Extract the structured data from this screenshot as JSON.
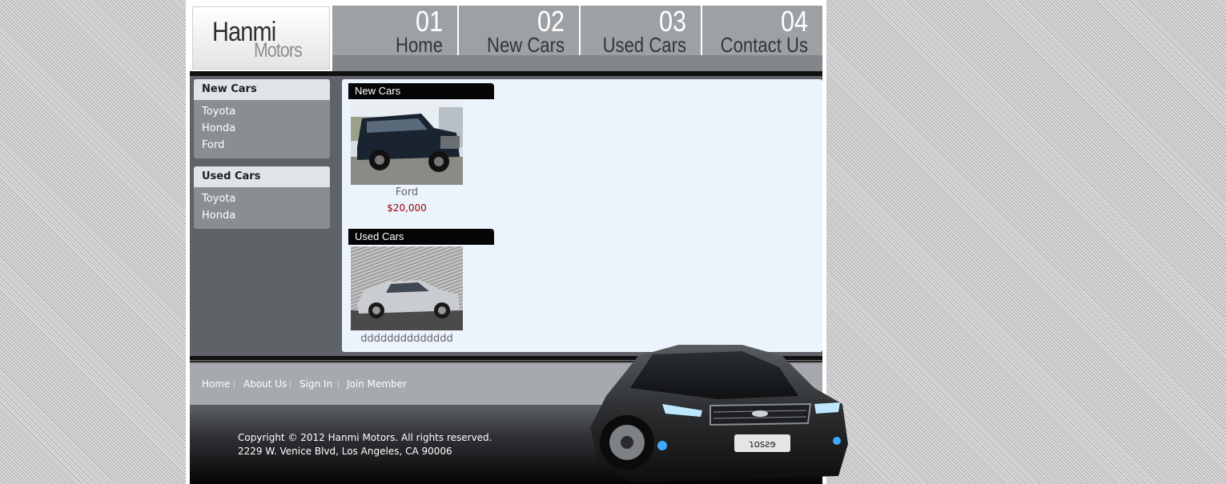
{
  "brand": {
    "line1": "Hanmi",
    "line2": "Motors"
  },
  "nav": [
    {
      "num": "01",
      "label": "Home"
    },
    {
      "num": "02",
      "label": "New Cars"
    },
    {
      "num": "03",
      "label": "Used Cars"
    },
    {
      "num": "04",
      "label": "Contact Us"
    }
  ],
  "sidebar": {
    "new": {
      "title": "New Cars",
      "items": [
        "Toyota",
        "Honda",
        "Ford"
      ]
    },
    "used": {
      "title": "Used Cars",
      "items": [
        "Toyota",
        "Honda"
      ]
    }
  },
  "content": {
    "new_section": {
      "title": "New Cars",
      "car": {
        "name": "Ford",
        "price": "$20,000"
      }
    },
    "used_section": {
      "title": "Used Cars",
      "car": {
        "name": "dddddddddddddd"
      }
    }
  },
  "footer": {
    "links": [
      "Home",
      "About Us",
      "Sign In",
      "Join Member"
    ],
    "separator": "|",
    "copyright": "Copyright © 2012 Hanmi Motors. All rights reserved.",
    "address": "2229 W. Venice Blvd, Los Angeles, CA 90006"
  },
  "colors": {
    "nav_bg": "#9ea1a4",
    "sidebar_bg": "#5f6266",
    "content_bg": "#ebf3fd",
    "price": "#990000"
  },
  "icons": [
    "suv-photo",
    "sedan-photo",
    "sports-car-graphic"
  ]
}
